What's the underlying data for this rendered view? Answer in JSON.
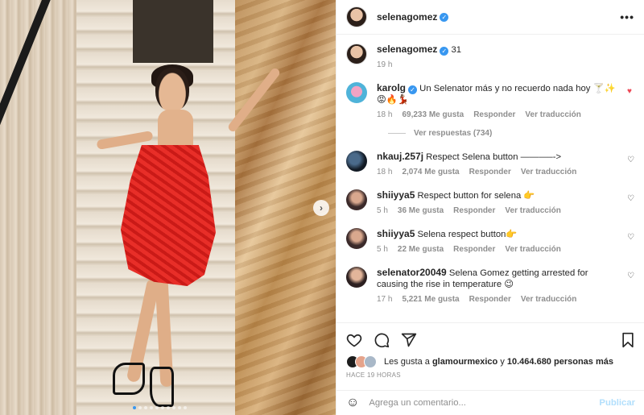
{
  "header": {
    "username": "selenagomez",
    "more_label": "•••"
  },
  "caption": {
    "username": "selenagomez",
    "text": "31",
    "time": "19 h"
  },
  "comments": [
    {
      "username": "karolg",
      "verified": true,
      "text": "Un Selenator más y no recuerdo nada hoy 🍸✨😡🔥💃🏽",
      "time": "18 h",
      "likes": "69,233 Me gusta",
      "reply": "Responder",
      "translate": "Ver traducción",
      "liked": true
    },
    {
      "username": "nkauj.257j",
      "text": "Respect Selena button ———–->",
      "time": "18 h",
      "likes": "2,074 Me gusta",
      "reply": "Responder",
      "translate": "Ver traducción"
    },
    {
      "username": "shiiyya5",
      "text": "Respect button for selena 👉",
      "time": "5 h",
      "likes": "36 Me gusta",
      "reply": "Responder",
      "translate": "Ver traducción"
    },
    {
      "username": "shiiyya5",
      "text": "Selena respect button👉",
      "time": "5 h",
      "likes": "22 Me gusta",
      "reply": "Responder",
      "translate": "Ver traducción"
    },
    {
      "username": "selenator20049",
      "text": "Selena Gomez getting arrested for causing the rise in temperature 😉",
      "time": "17 h",
      "likes": "5,221 Me gusta",
      "reply": "Responder",
      "translate": "Ver traducción"
    }
  ],
  "view_replies": "Ver respuestas (734)",
  "likes_line": {
    "prefix": "Les gusta a",
    "user": "glamourmexico",
    "middle": "y",
    "count": "10.464.680 personas más"
  },
  "posted_time": "HACE 19 HORAS",
  "comment_input": {
    "placeholder": "Agrega un comentario...",
    "publish_label": "Publicar"
  },
  "colors": {
    "accent_blue": "#3897f0",
    "like_red": "#ed4956",
    "publish_disabled": "#b2dffc",
    "meta_gray": "#8e8e8e"
  },
  "carousel": {
    "current_slide": 1,
    "total_slides": 10
  }
}
